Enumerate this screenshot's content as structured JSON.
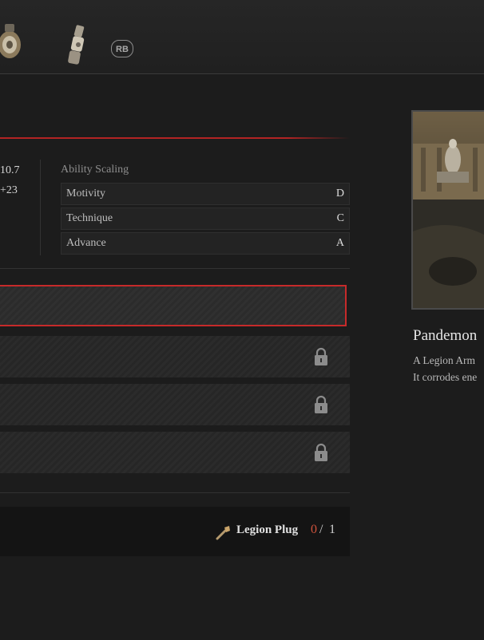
{
  "header": {
    "rb_badge": "RB"
  },
  "stats": {
    "value_1": "10.7",
    "value_2": "+23"
  },
  "scaling": {
    "title": "Ability Scaling",
    "rows": [
      {
        "label": "Motivity",
        "grade": "D"
      },
      {
        "label": "Technique",
        "grade": "C"
      },
      {
        "label": "Advance",
        "grade": "A"
      }
    ]
  },
  "material": {
    "name": "Legion Plug",
    "have": "0",
    "separator": "/",
    "need": "1"
  },
  "item": {
    "name": "Pandemon",
    "desc_line1": "A Legion Arm",
    "desc_line2": "It corrodes ene"
  },
  "icons": [
    "gauntlet-icon",
    "legion-arm-icon",
    "lock-icon",
    "legion-plug-icon"
  ],
  "colors": {
    "accent_red": "#c62a2a",
    "material_missing": "#d0533c"
  }
}
